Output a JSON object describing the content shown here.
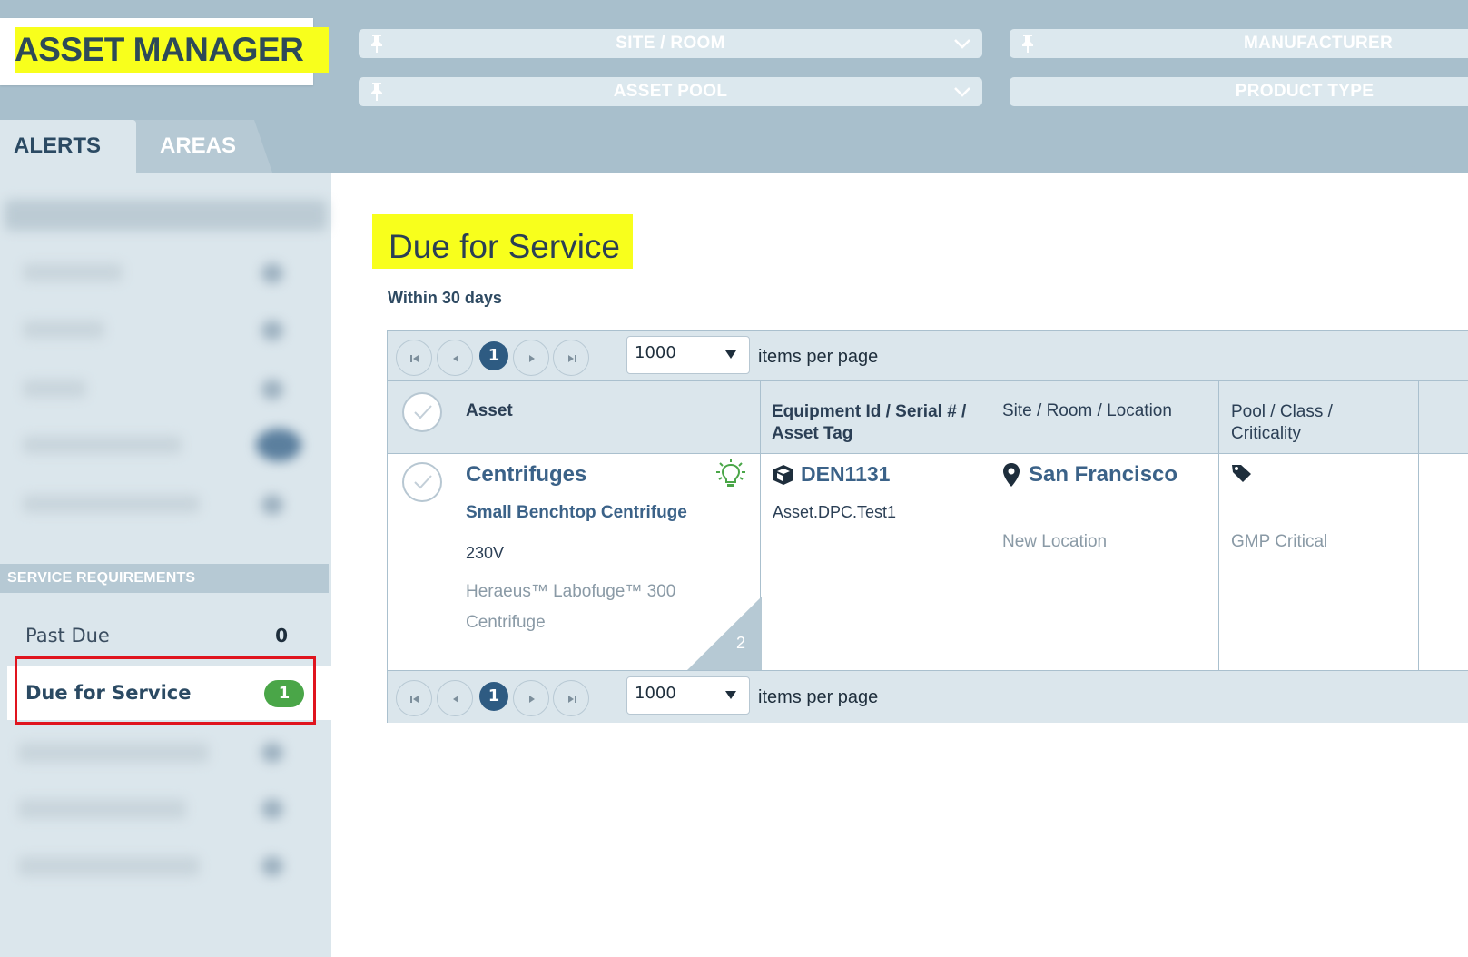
{
  "app": {
    "title": "ASSET MANAGER"
  },
  "filters": [
    {
      "label": "SITE / ROOM",
      "pinned": true,
      "dropdown": true
    },
    {
      "label": "MANUFACTURER",
      "pinned": true,
      "dropdown": false
    },
    {
      "label": "ASSET POOL",
      "pinned": true,
      "dropdown": true
    },
    {
      "label": "PRODUCT TYPE",
      "pinned": false,
      "dropdown": false
    }
  ],
  "tabs": {
    "alerts": "ALERTS",
    "areas": "AREAS"
  },
  "sidebar": {
    "section_header": "SERVICE REQUIREMENTS",
    "items": [
      {
        "label": "Past Due",
        "count": "0"
      },
      {
        "label": "Due for Service",
        "count": "1"
      }
    ]
  },
  "main": {
    "title": "Due for Service",
    "subtitle": "Within 30 days"
  },
  "pager": {
    "current_page": "1",
    "page_size": "1000",
    "items_label": "items per page"
  },
  "table": {
    "columns": [
      {
        "label": "Asset"
      },
      {
        "label": "Equipment Id / Serial # / Asset Tag"
      },
      {
        "label": "Site / Room / Location"
      },
      {
        "label": "Pool / Class / Criticality"
      }
    ],
    "rows": [
      {
        "asset_name": "Centrifuges",
        "asset_model": "Small Benchtop Centrifuge",
        "asset_voltage": "230V",
        "asset_desc_1": "Heraeus™ Labofuge™ 300",
        "asset_desc_2": "Centrifuge",
        "corner_count": "2",
        "equipment_id": "DEN1131",
        "serial": "Asset.DPC.Test1",
        "site": "San Francisco",
        "location": "New Location",
        "criticality": "GMP Critical"
      }
    ]
  },
  "colors": {
    "header_bg": "#a8bfcc",
    "sidebar_bg": "#dbe6ec",
    "highlight": "#f8ff1c",
    "badge_green": "#4aa648",
    "pager_active": "#2e5b82",
    "callout_red": "#e0141e"
  },
  "icons": {
    "pin": "pin-icon",
    "chevron": "chevron-down-icon",
    "lightbulb": "lightbulb-icon",
    "box": "box-icon",
    "map_pin": "map-marker-icon",
    "tag": "tag-icon",
    "check": "check-icon"
  }
}
